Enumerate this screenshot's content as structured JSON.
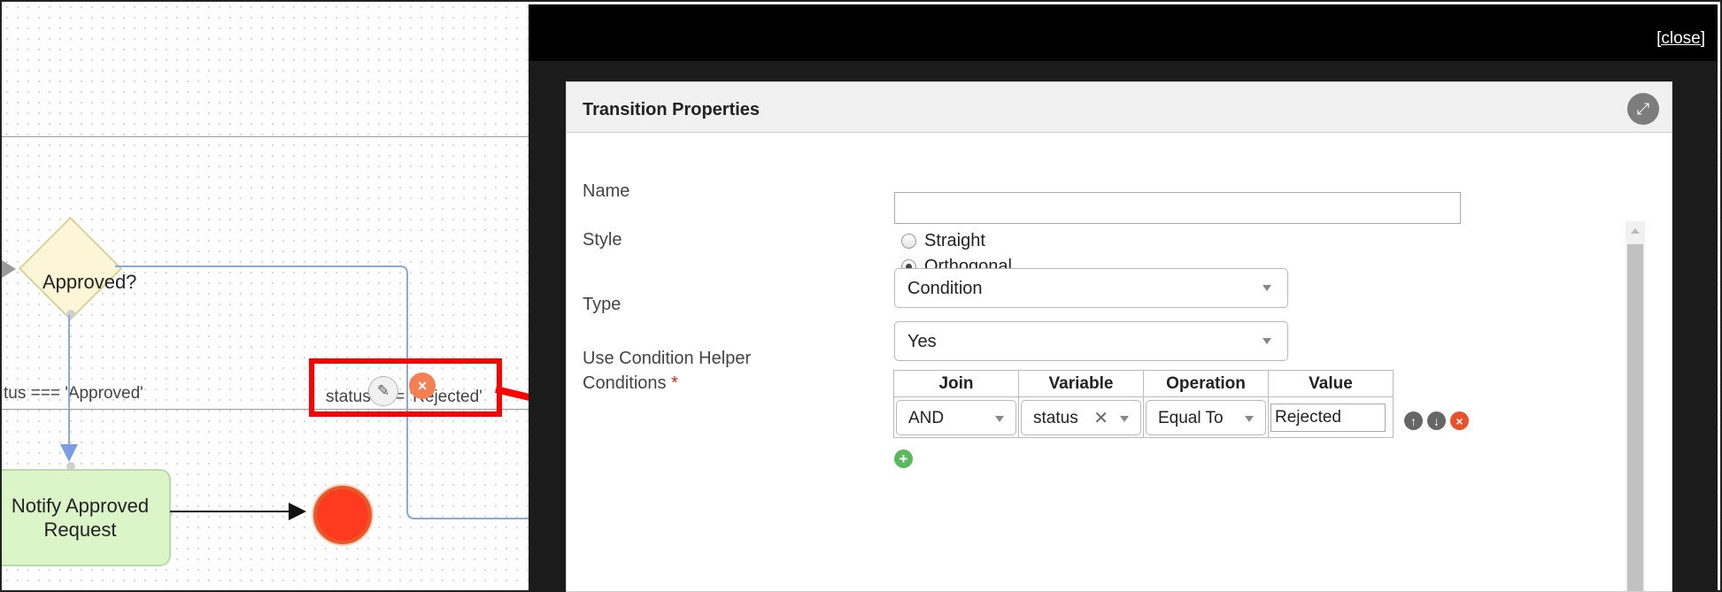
{
  "canvas": {
    "decision_label": "Approved?",
    "task_label_line1": "Notify Approved",
    "task_label_line2": "Request",
    "edge_rejected_label": "status === 'Rejected'",
    "edge_approved_label": "tus === 'Approved'",
    "edit_icon": "pencil-icon",
    "delete_icon": "close-icon"
  },
  "modal": {
    "close_label": "[close]",
    "title": "Transition Properties",
    "expand_icon": "expand-icon",
    "fields": {
      "name_label": "Name",
      "name_value": "",
      "style_label": "Style",
      "style_options": [
        "Straight",
        "Orthogonal"
      ],
      "style_selected": "Orthogonal",
      "type_label": "Type",
      "type_value": "Condition",
      "helper_label": "Use Condition Helper",
      "helper_value": "Yes",
      "conditions_label": "Conditions",
      "required_marker": "*"
    },
    "conditions": {
      "headers": [
        "Join",
        "Variable",
        "Operation",
        "Value"
      ],
      "rows": [
        {
          "join": "AND",
          "variable": "status",
          "operation": "Equal To",
          "value": "Rejected"
        }
      ]
    }
  },
  "colors": {
    "highlight": "#ff0000",
    "end_event": "#ff3b1f",
    "task_fill": "#dcf5c8",
    "decision_fill": "#fdf6d6"
  }
}
